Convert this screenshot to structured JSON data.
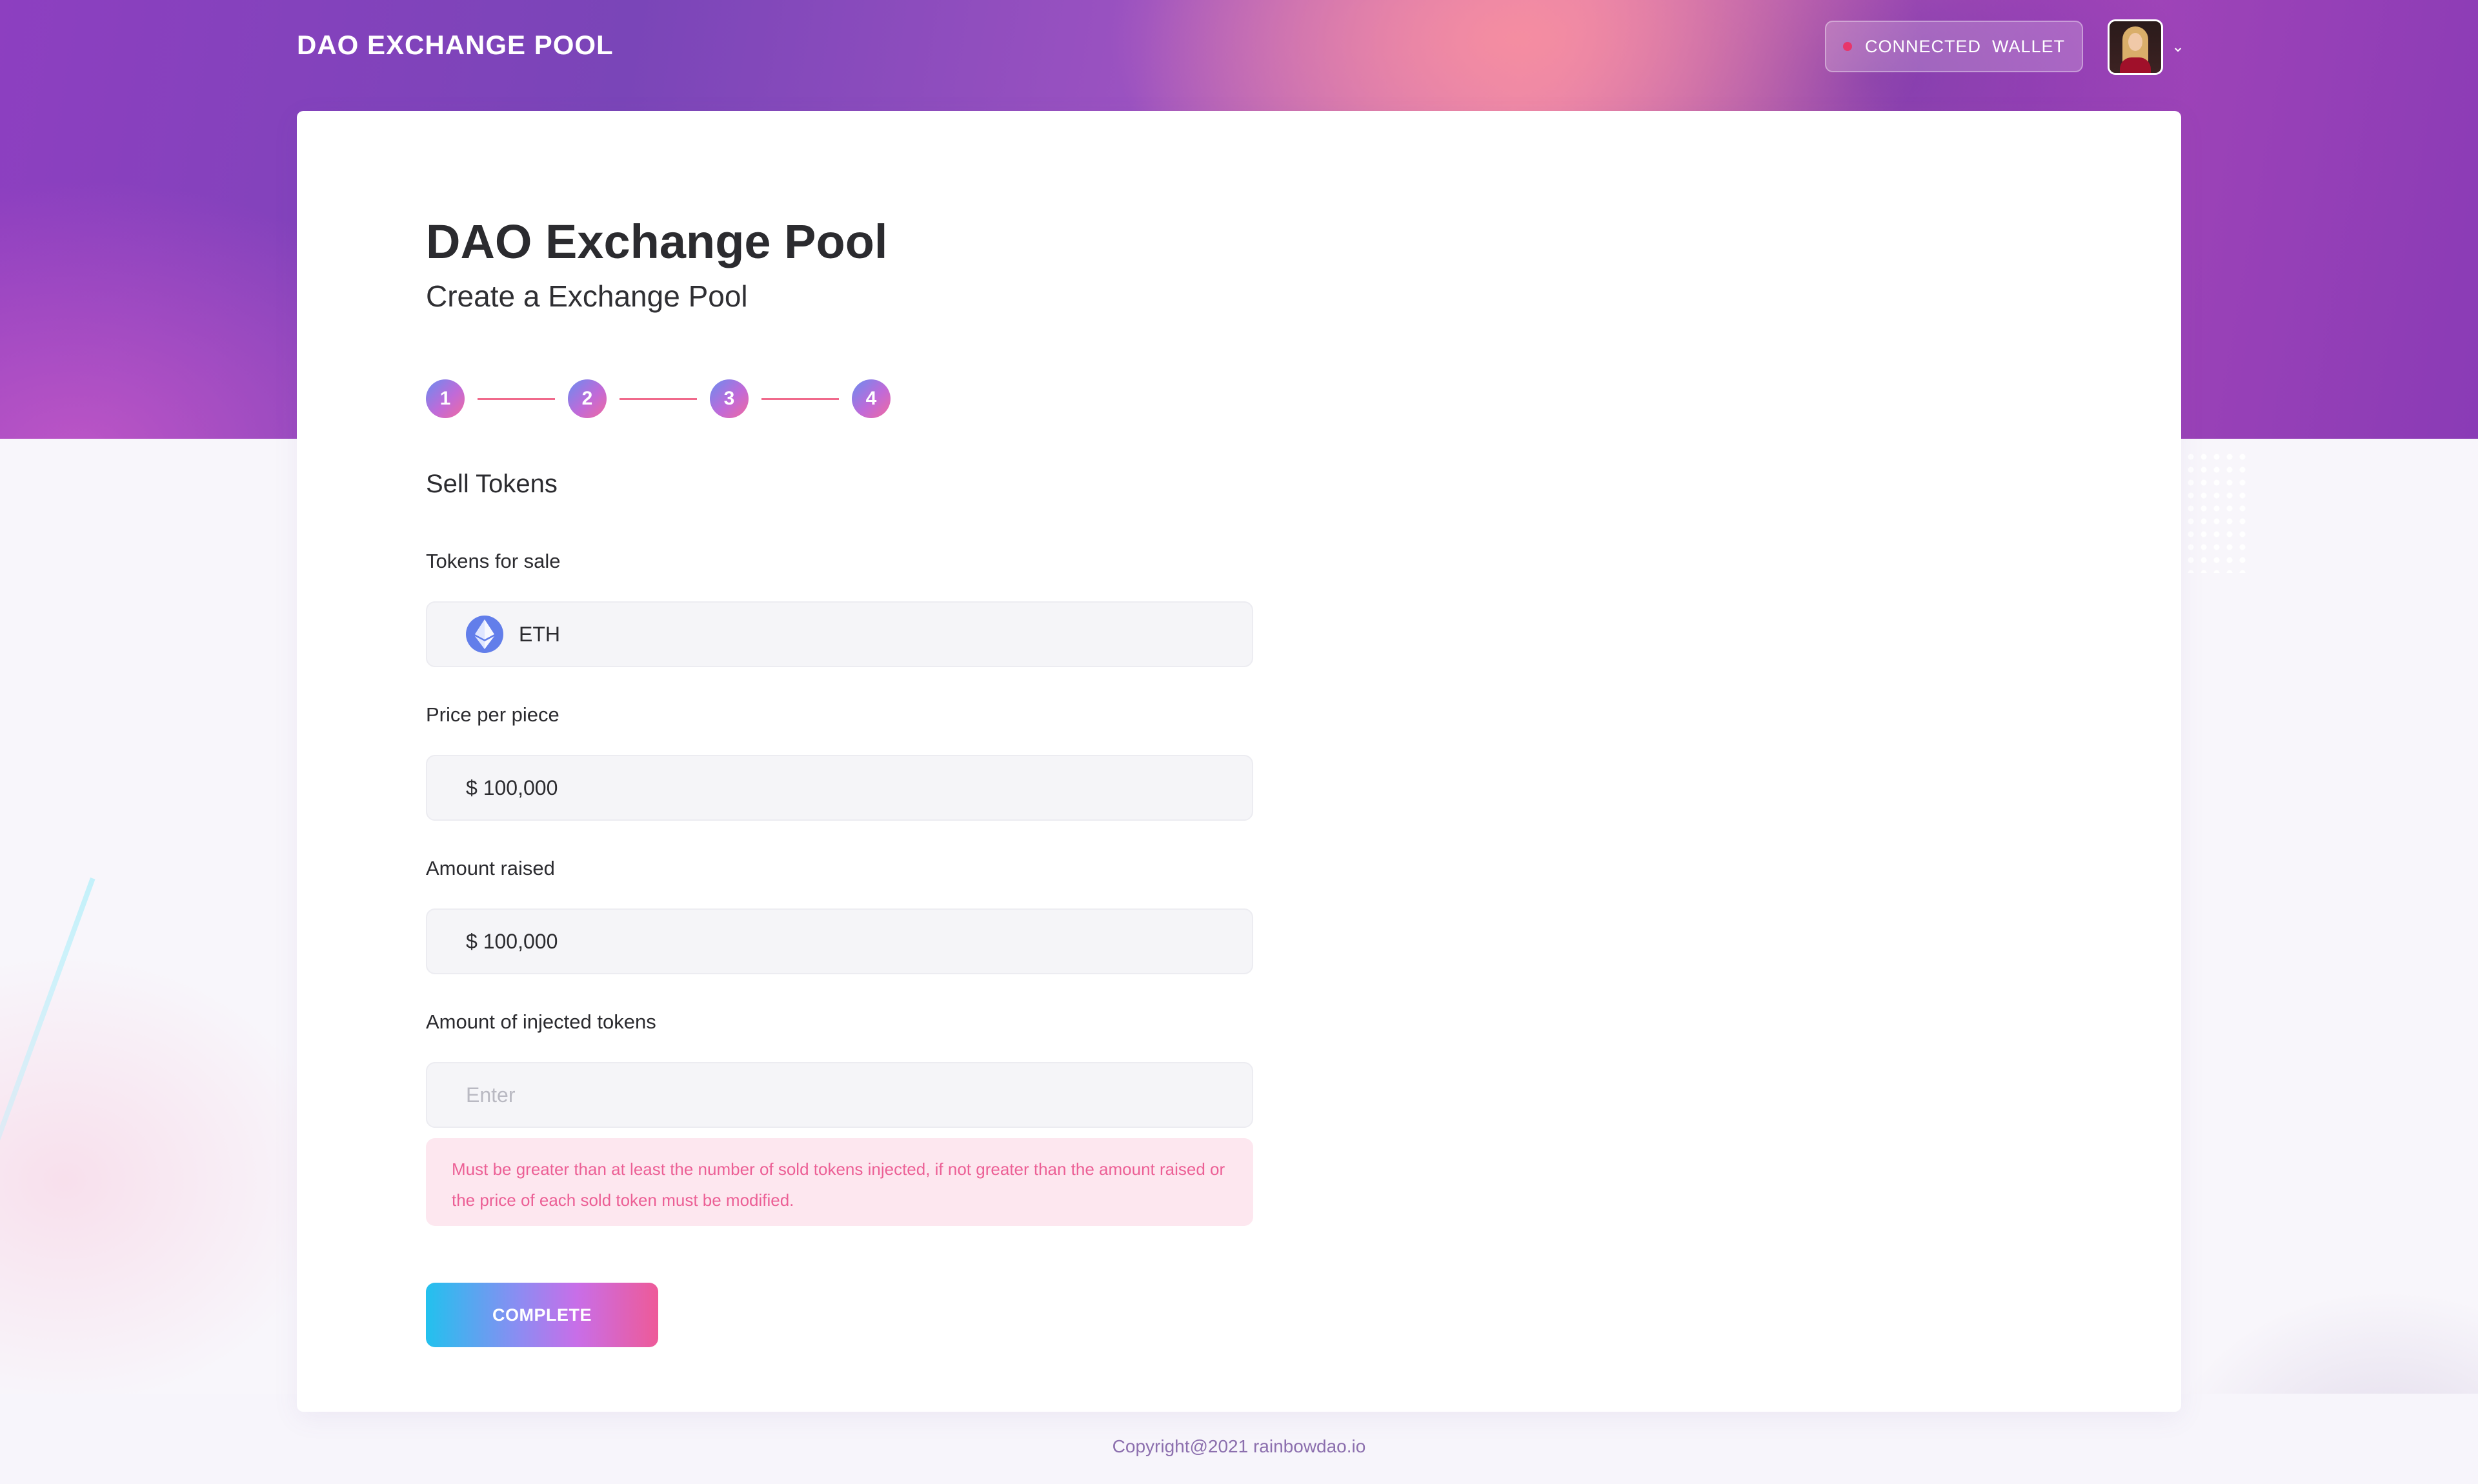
{
  "header": {
    "brand": "DAO EXCHANGE POOL",
    "wallet_label": "CONNECTED  WALLET",
    "avatar_icon": "user-avatar",
    "dropdown_icon": "chevron-down-icon"
  },
  "main": {
    "title": "DAO Exchange Pool",
    "subtitle": "Create a Exchange Pool",
    "steps": [
      "1",
      "2",
      "3",
      "4"
    ],
    "section_title": "Sell Tokens",
    "fields": {
      "tokens_for_sale": {
        "label": "Tokens for sale",
        "value": "ETH",
        "icon": "ethereum-icon"
      },
      "price_per_piece": {
        "label": "Price per piece",
        "value": "$ 100,000"
      },
      "amount_raised": {
        "label": "Amount raised",
        "value": "$ 100,000"
      },
      "injected_tokens": {
        "label": "Amount of injected tokens",
        "value": "",
        "placeholder": "Enter"
      }
    },
    "warning": "Must be greater than at least the number of sold tokens injected, if not greater than the amount raised or the price of each sold token must be modified.",
    "complete_label": "COMPLETE"
  },
  "footer": {
    "copyright": "Copyright@2021 rainbowdao.io"
  },
  "colors": {
    "accent_pink": "#f06a8c",
    "warning_bg": "#fde7ef",
    "warning_text": "#ec5f95",
    "eth_blue": "#627eea"
  }
}
